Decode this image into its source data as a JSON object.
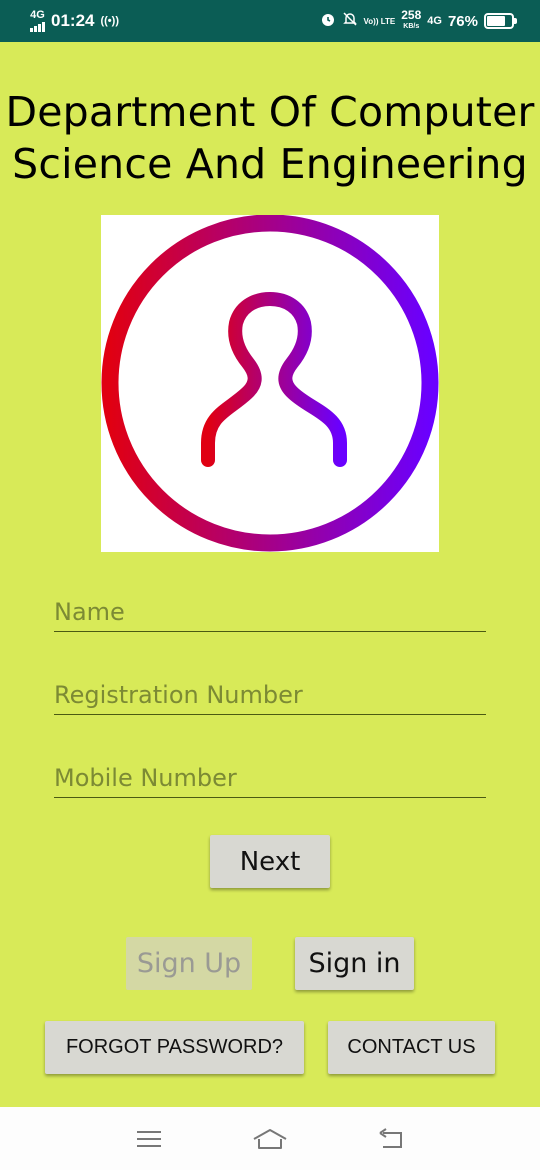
{
  "status_bar": {
    "network_type": "4G",
    "time": "01:24",
    "volte": "Vo)) LTE",
    "speed_value": "258",
    "speed_unit": "KB/s",
    "data_type": "4G",
    "battery_percent": "76%"
  },
  "header": {
    "title": "Department Of Computer Science And Engineering"
  },
  "form": {
    "name_placeholder": "Name",
    "name_value": "",
    "registration_placeholder": "Registration Number",
    "registration_value": "",
    "mobile_placeholder": "Mobile Number",
    "mobile_value": ""
  },
  "buttons": {
    "next": "Next",
    "sign_up": "Sign Up",
    "sign_in": "Sign in",
    "forgot_password": "FORGOT PASSWORD?",
    "contact_us": "CONTACT US"
  },
  "nav": {
    "menu_icon": "menu-icon",
    "home_icon": "home-icon",
    "back_icon": "back-icon"
  },
  "colors": {
    "status_bar": "#0b5d55",
    "background": "#d8ea58",
    "logo_gradient_start": "#e00012",
    "logo_gradient_end": "#6a00ff"
  }
}
